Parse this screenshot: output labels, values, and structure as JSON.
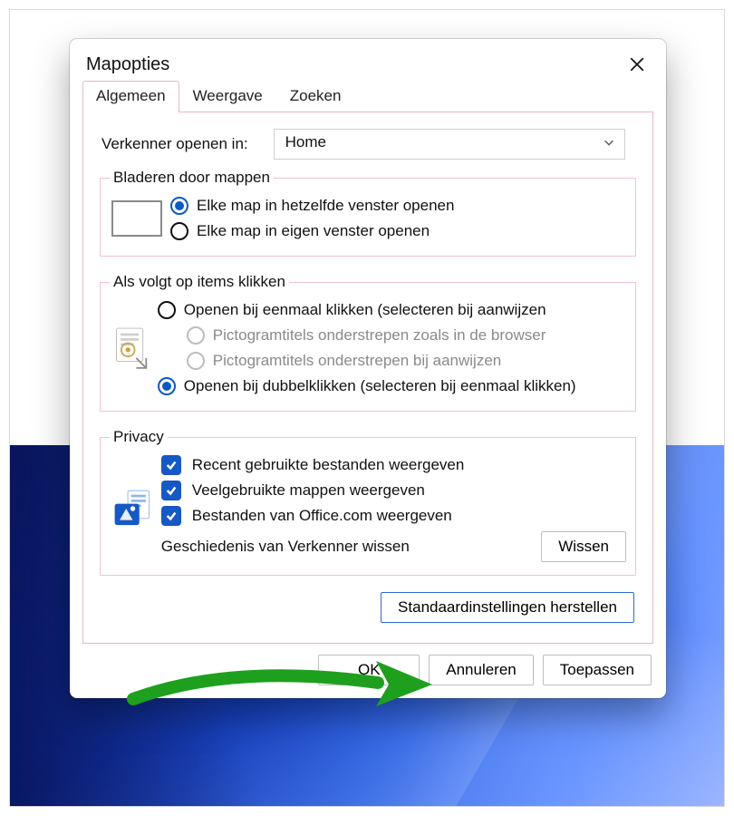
{
  "dialog": {
    "title": "Mapopties",
    "tabs": {
      "general": "Algemeen",
      "view": "Weergave",
      "search": "Zoeken"
    },
    "open_in_label": "Verkenner openen in:",
    "open_in_value": "Home",
    "browse": {
      "legend": "Bladeren door mappen",
      "same_window": "Elke map in hetzelfde venster openen",
      "own_window": "Elke map in eigen venster openen"
    },
    "click": {
      "legend": "Als volgt op items klikken",
      "single": "Openen bij eenmaal klikken (selecteren bij aanwijzen",
      "underline_browser": "Pictogramtitels onderstrepen zoals in de browser",
      "underline_point": "Pictogramtitels onderstrepen bij aanwijzen",
      "double": "Openen bij dubbelklikken (selecteren bij eenmaal klikken)"
    },
    "privacy": {
      "legend": "Privacy",
      "recent": "Recent gebruikte bestanden weergeven",
      "frequent": "Veelgebruikte mappen weergeven",
      "office": "Bestanden van Office.com weergeven",
      "history_label": "Geschiedenis van Verkenner wissen",
      "clear_btn": "Wissen"
    },
    "restore_btn": "Standaardinstellingen herstellen",
    "ok": "OK",
    "cancel": "Annuleren",
    "apply": "Toepassen"
  }
}
